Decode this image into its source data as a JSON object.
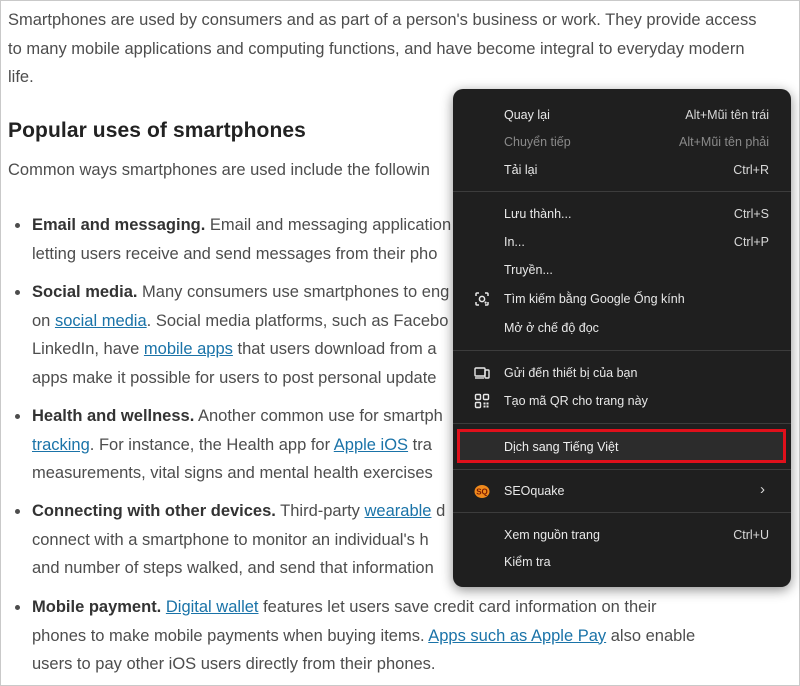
{
  "article": {
    "paragraph": "Smartphones are used by consumers and as part of a person's business or work. They provide access to many mobile applications and computing functions, and have become integral to everyday modern life.",
    "heading": "Popular uses of smartphones",
    "intro": "Common ways smartphones are used include the followin",
    "bullets": [
      {
        "title": "Email and messaging.",
        "line1": " Email and messaging application",
        "line2": "letting users receive and send messages from their pho"
      },
      {
        "title": "Social media.",
        "line1": " Many consumers use smartphones to eng",
        "line2_a": "on ",
        "link1": "social media",
        "line2_b": ". Social media platforms, such as Facebo",
        "line3_a": "LinkedIn, have ",
        "link2": "mobile apps",
        "line3_b": " that users download from a",
        "line4": "apps make it possible for users to post personal update"
      },
      {
        "title": "Health and wellness.",
        "line1": " Another common use for smartph",
        "link1": "tracking",
        "line2_b": ". For instance, the Health app for ",
        "link2": "Apple iOS",
        "line2_c": " tra",
        "line3": "measurements, vital signs and mental health exercises"
      },
      {
        "title": "Connecting with other devices.",
        "line1": " Third-party ",
        "link1": "wearable",
        "line1_b": " d",
        "line2": "connect with a smartphone to monitor an individual's h",
        "line3": "and number of steps walked, and send that information"
      },
      {
        "title": "Mobile payment.",
        "line1_a": " ",
        "link1": "Digital wallet",
        "line1_b": " features let users save credit card information on their",
        "line2_a": "phones to make mobile payments when buying items. ",
        "link2": "Apps such as Apple Pay",
        "line2_b": " also enable",
        "line3": "users to pay other iOS users directly from their phones."
      }
    ]
  },
  "context_menu": {
    "items": [
      {
        "label": "Quay lại",
        "shortcut": "Alt+Mũi tên trái"
      },
      {
        "label": "Chuyển tiếp",
        "shortcut": "Alt+Mũi tên phải",
        "disabled": true
      },
      {
        "label": "Tải lại",
        "shortcut": "Ctrl+R"
      },
      {
        "label": "Lưu thành...",
        "shortcut": "Ctrl+S"
      },
      {
        "label": "In...",
        "shortcut": "Ctrl+P"
      },
      {
        "label": "Truyền..."
      },
      {
        "label": "Tìm kiếm bằng Google Ống kính",
        "icon": "google-lens-icon"
      },
      {
        "label": "Mở ở chế độ đọc"
      },
      {
        "label": "Gửi đến thiết bị của bạn",
        "icon": "send-to-device-icon"
      },
      {
        "label": "Tạo mã QR cho trang này",
        "icon": "qr-code-icon"
      },
      {
        "label": "Dịch sang Tiếng Việt",
        "highlighted": true
      },
      {
        "label": "SEOquake",
        "icon": "seoquake-icon",
        "submenu": true
      },
      {
        "label": "Xem nguồn trang",
        "shortcut": "Ctrl+U"
      },
      {
        "label": "Kiểm tra"
      }
    ],
    "highlight_color": "#e0101b"
  }
}
